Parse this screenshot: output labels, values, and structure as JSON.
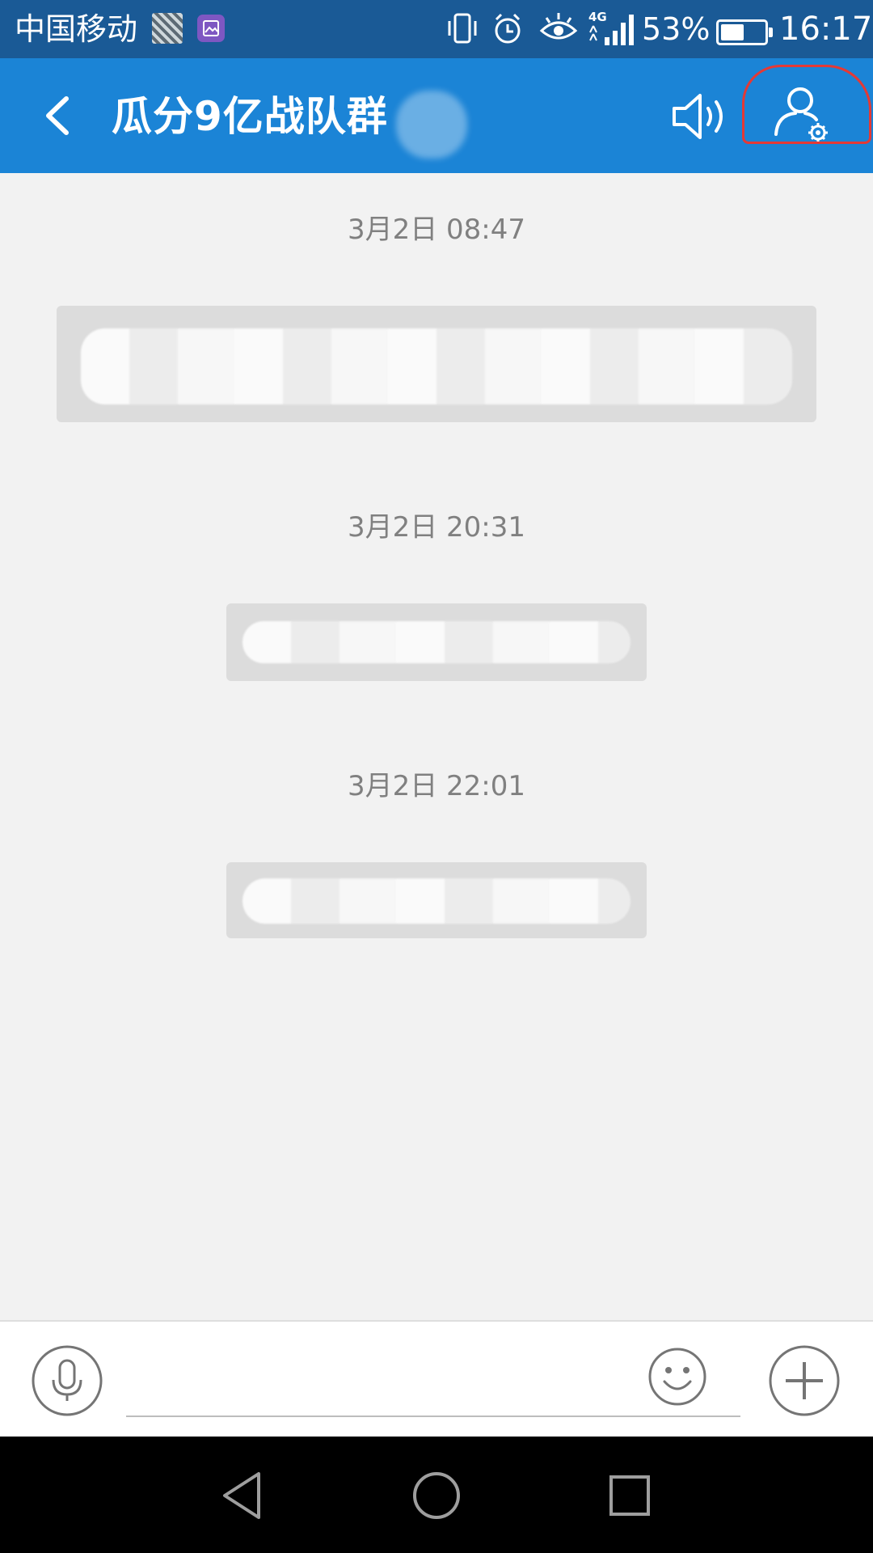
{
  "status_bar": {
    "carrier": "中国移动",
    "network": "4G",
    "battery_percent": "53%",
    "battery_level": 0.53,
    "time": "16:17",
    "icons": [
      "photo-thumbnail-icon",
      "gallery-icon",
      "vibrate-icon",
      "alarm-icon",
      "eye-comfort-icon",
      "signal-icon",
      "battery-icon"
    ]
  },
  "header": {
    "title": "瓜分9亿战队群",
    "icons": [
      "back-arrow-icon",
      "speaker-icon",
      "group-settings-icon"
    ]
  },
  "messages": [
    {
      "timestamp": "3月2日 08:47"
    },
    {
      "timestamp": "3月2日 20:31"
    },
    {
      "timestamp": "3月2日 22:01"
    }
  ],
  "input_bar": {
    "placeholder": "",
    "icons": [
      "microphone-icon",
      "emoji-icon",
      "add-icon"
    ]
  },
  "nav_bar": {
    "icons": [
      "nav-back-icon",
      "nav-home-icon",
      "nav-recents-icon"
    ]
  },
  "colors": {
    "status_bar": "#1a5a96",
    "title_bar": "#1b84d6",
    "chat_background": "#f2f2f2",
    "system_message": "#dcdcdc",
    "highlight": "#e53935"
  }
}
